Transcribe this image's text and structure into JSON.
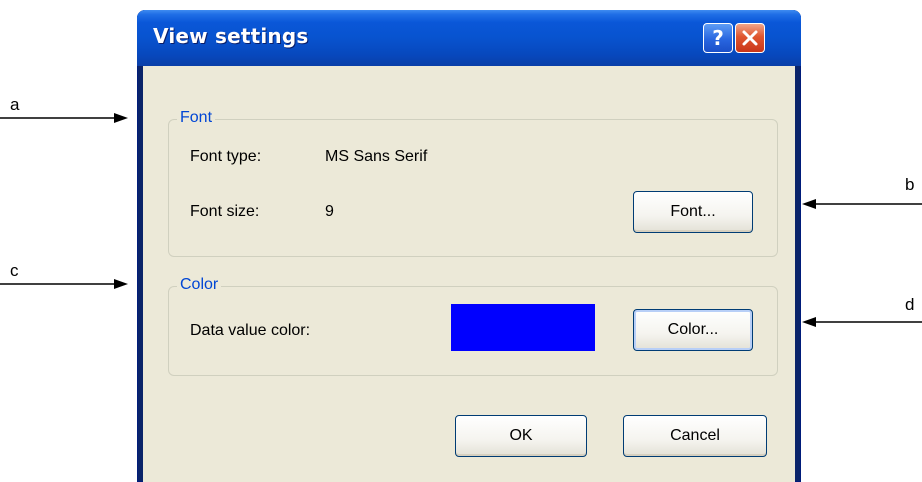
{
  "callouts": {
    "a": "a",
    "b": "b",
    "c": "c",
    "d": "d"
  },
  "dialog": {
    "title": "View settings",
    "help_glyph": "?",
    "close_glyph": "✕",
    "font_group": {
      "title": "Font",
      "font_type_label": "Font type:",
      "font_type_value": "MS Sans Serif",
      "font_size_label": "Font size:",
      "font_size_value": "9",
      "font_button": "Font..."
    },
    "color_group": {
      "title": "Color",
      "data_value_color_label": "Data value color:",
      "data_value_color": "#0000ff",
      "color_button": "Color..."
    },
    "ok_button": "OK",
    "cancel_button": "Cancel"
  },
  "icons": {
    "help": "help-icon",
    "close": "close-icon",
    "arrow": "arrow-icon"
  }
}
